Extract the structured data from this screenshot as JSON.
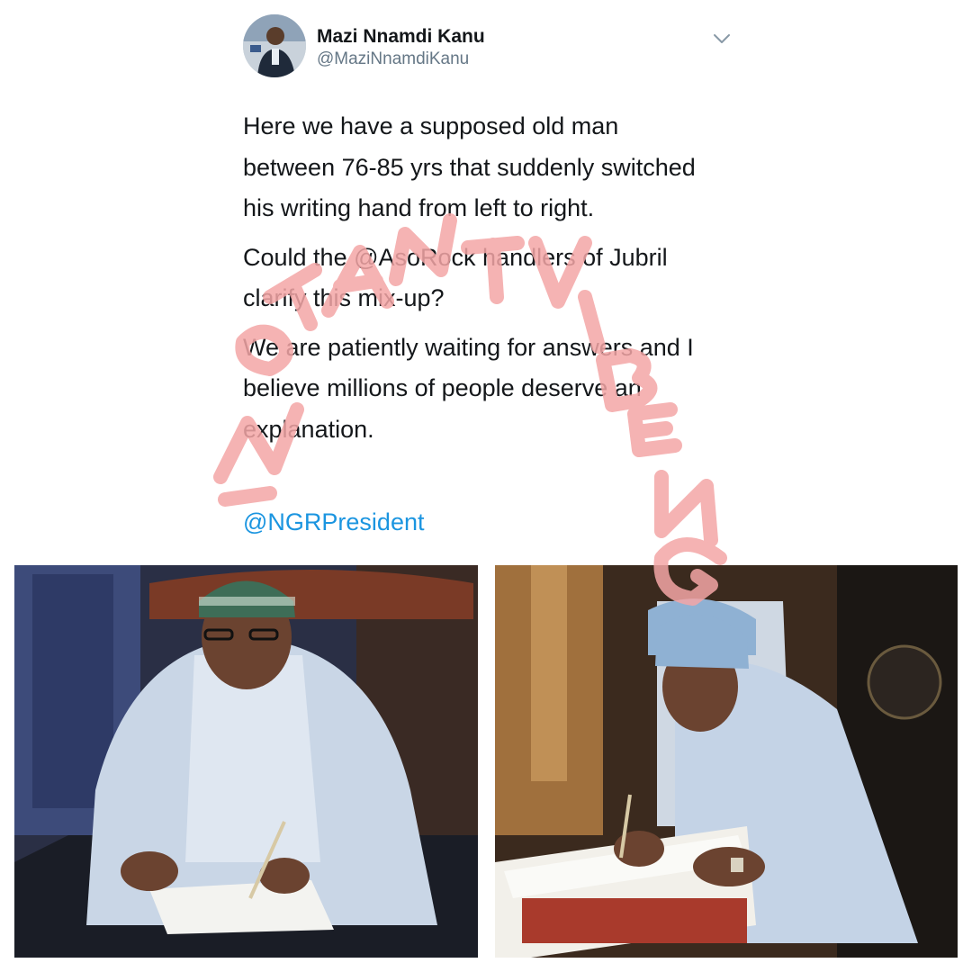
{
  "tweet": {
    "display_name": "Mazi Nnamdi Kanu",
    "handle": "@MaziNnamdiKanu",
    "paragraphs": [
      "Here we have a supposed old man between 76-85 yrs that suddenly switched his writing hand from left to right.",
      "Could the @AsoRock handlers of Jubril clarify this mix-up?",
      "We are patiently waiting for answers and I believe millions of people deserve an explanation."
    ],
    "mention": "@NGRPresident",
    "menu_icon": "chevron-down-icon"
  },
  "images": [
    {
      "name": "photo-left",
      "description_icon": "photo"
    },
    {
      "name": "photo-right",
      "description_icon": "photo"
    }
  ],
  "watermark": {
    "text": "INSTANTVIBENG",
    "color": "#f4a6a6"
  },
  "colors": {
    "link": "#1b95e0",
    "text": "#14171a",
    "secondary": "#657786"
  }
}
